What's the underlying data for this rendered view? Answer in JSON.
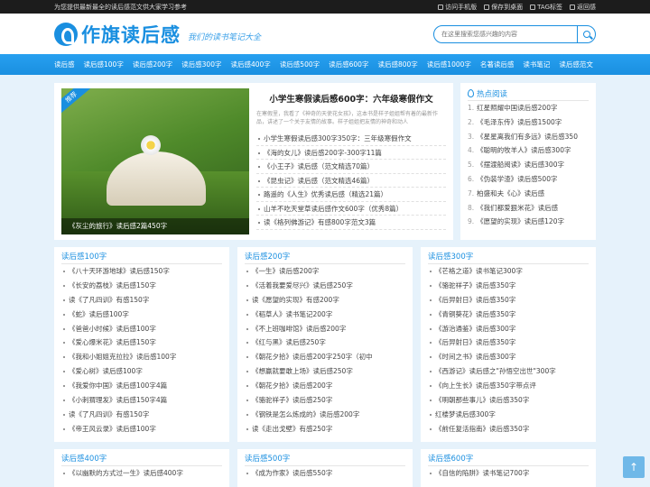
{
  "topbar": {
    "tagline": "为您提供最新最全的读后感范文供大家学习参考",
    "links": [
      "访问手机版",
      "保存到桌面",
      "TAG标签",
      "返回感"
    ]
  },
  "header": {
    "logo_text": "作旗读后感",
    "slogan": "我们的读书笔记大全",
    "search_placeholder": "在这里搜索您感兴趣的内容"
  },
  "nav": [
    "读后感",
    "读后感100字",
    "读后感200字",
    "读后感300字",
    "读后感400字",
    "读后感500字",
    "读后感600字",
    "读后感800字",
    "读后感1000字",
    "名著读后感",
    "读书笔记",
    "读后感范文"
  ],
  "featured": {
    "badge": "推荐",
    "image_caption": "《灰尘的旅行》读后感2篇450字",
    "title": "小学生寒假读后感600字：六年级寒假作文",
    "summary": "在寒假里，我看了《神奇的天使花女孩》，这本书是样子姐姐帮有着的最新作品，讲述了一个关于友情的故事。样子姐姐把友情的神奇和动人",
    "list": [
      "小学生寒假读后感300字350字：三年级寒假作文",
      "《海的女儿》读后感200字-300字11篇",
      "《小王子》读后感（范文精选70篇）",
      "《昆虫记》读后感（范文精选46篇）",
      "路遥的《人生》优秀读后感（精选21篇）",
      "山羊不吃天堂草读后感作文600字（优秀8篇）",
      "读《格列佛游记》有感800字范文3篇"
    ]
  },
  "hot": {
    "title": "热点阅读",
    "items": [
      "红星照耀中国读后感200字",
      "《毛泽东传》读后感1500字",
      "《星星离我们有多远》读后感350",
      "《聪明的牧羊人》读后感300字",
      "《摆渡船阅读》读后感300字",
      "《伪装学渣》读后感500字",
      "柏盛和夫《心》读后感",
      "《我们都爱狠米花》读后感",
      "《愿望的实现》读后感120字"
    ]
  },
  "categories": [
    {
      "title": "读后感100字",
      "items": [
        "《八十天环游地球》读后感150字",
        "《长安的荔枝》读后感150字",
        "读《了凡四训》有感150字",
        "《蛇》读后感100字",
        "《爸爸小时候》读后感100字",
        "《爱心爆米花》读后感150字",
        "《我和小姐姐克拉拉》读后感100字",
        "《爱心树》读后感100字",
        "《我爱你中国》读后感100字4篇",
        "《小刺猬理发》读后感150字4篇",
        "读《了凡四训》有感150字",
        "《帝王风云录》读后感100字"
      ]
    },
    {
      "title": "读后感200字",
      "items": [
        "《一生》读后感200字",
        "《活着我要爱尽兴》读后感250字",
        "读《愿望的实现》有感200字",
        "《稻草人》读书笔记200字",
        "《不上班咖啡馆》读后感200字",
        "《红与黑》读后感250字",
        "《朝花夕拾》读后感200字250字（初中",
        "《想赢就要敢上场》读后感250字",
        "《朝花夕拾》读后感200字",
        "《骆驼祥子》读后感250字",
        "《钢铁是怎么炼成的》读后感200字",
        "读《走出戈壁》有感250字"
      ]
    },
    {
      "title": "读后感300字",
      "items": [
        "《芒格之道》读书笔记300字",
        "《骆驼祥子》读后感350字",
        "《后羿射日》读后感350字",
        "《青铜葵花》读后感350字",
        "《游治通鉴》读后感300字",
        "《后羿射日》读后感350字",
        "《时间之书》读后感300字",
        "《西游记》读后感之\"孙悟空出世\"300字",
        "《向上生长》读后感350字带点评",
        "《明朝那些事儿》读后感350字",
        "红楼梦读后感300字",
        "《前任复活指南》读后感350字"
      ]
    }
  ],
  "categories2": [
    {
      "title": "读后感400字",
      "items": [
        "《以幽默的方式过一生》读后感400字"
      ]
    },
    {
      "title": "读后感500字",
      "items": [
        "《成为作家》读后感550字"
      ]
    },
    {
      "title": "读后感600字",
      "items": [
        "《自信的陷阱》读书笔记700字"
      ]
    }
  ],
  "backtop": "↑"
}
